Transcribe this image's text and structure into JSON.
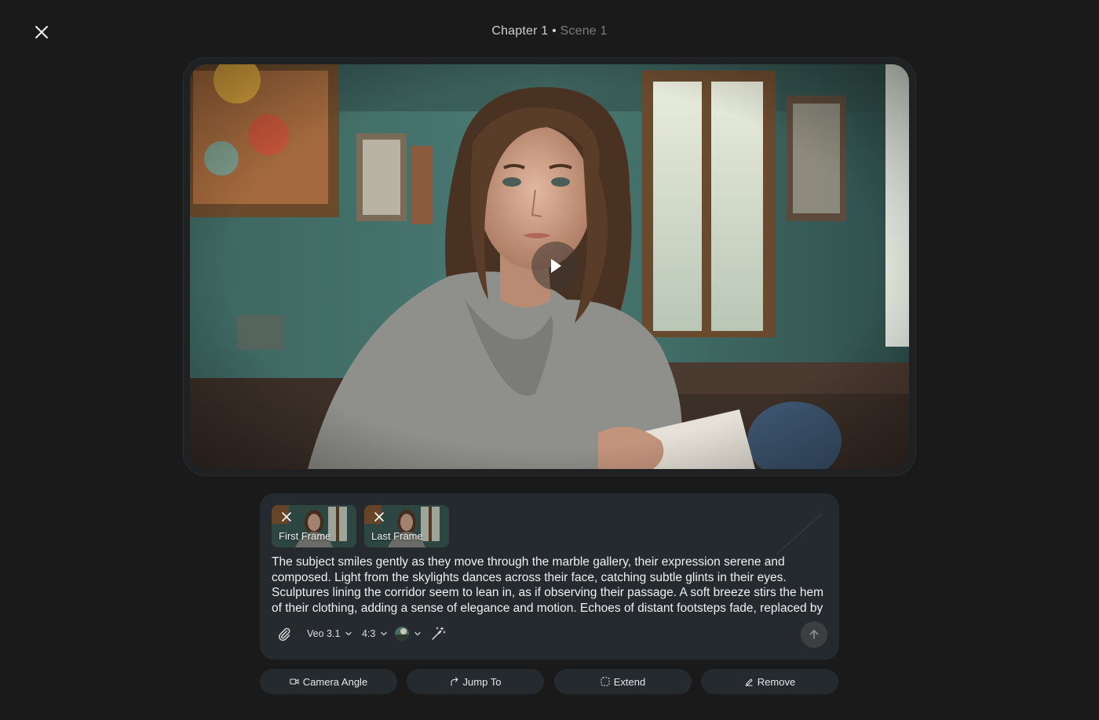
{
  "header": {
    "chapter": "Chapter 1",
    "separator": "•",
    "scene": "Scene 1"
  },
  "player": {
    "play_icon": "play-icon"
  },
  "prompt": {
    "frames": [
      {
        "label": "First Frame"
      },
      {
        "label": "Last Frame"
      }
    ],
    "text": "The subject smiles gently as they move through the marble gallery, their expression serene and composed. Light from the skylights dances across their face, catching subtle glints in their eyes. Sculptures lining the corridor seem to lean in, as if observing their passage. A soft breeze stirs the hem of their clothing, adding a sense of elegance and motion. Echoes of distant footsteps fade, replaced by",
    "toolbar": {
      "model": "Veo 3.1",
      "aspect": "4:3"
    }
  },
  "actions": {
    "camera_angle": "Camera Angle",
    "jump_to": "Jump To",
    "extend": "Extend",
    "remove": "Remove"
  },
  "colors": {
    "background": "#1a1a1b",
    "card": "#252a2e",
    "muted_text": "#7d7d7d"
  }
}
